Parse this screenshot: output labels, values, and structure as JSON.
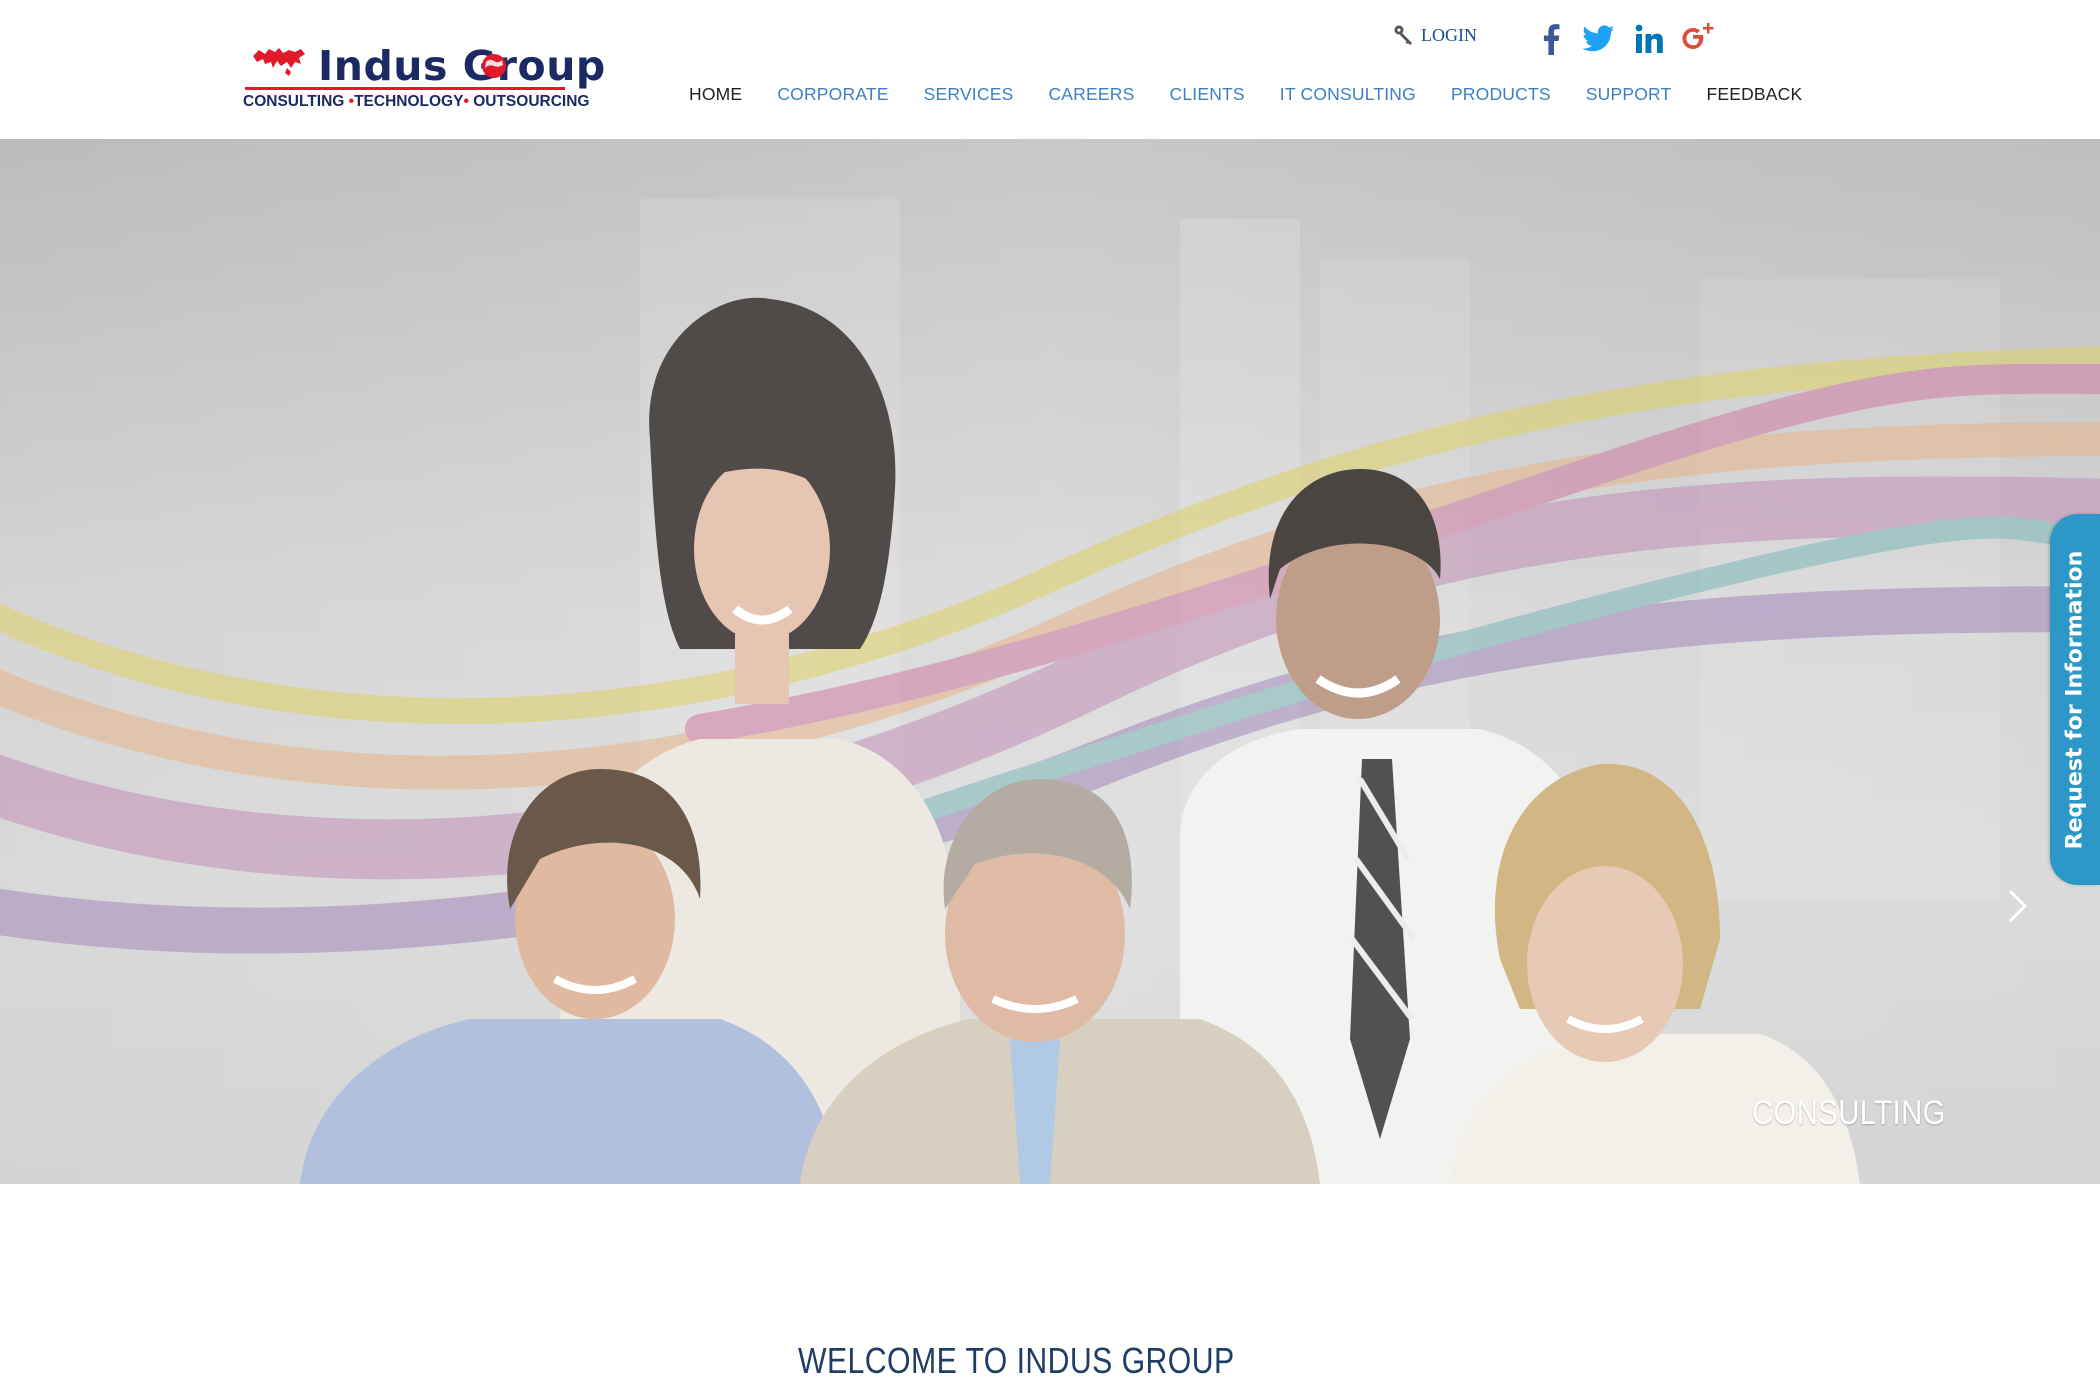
{
  "brand": {
    "name": "Indus Group",
    "tagline_parts": [
      "CONSULTING",
      "TECHNOLOGY",
      "OUTSOURCING"
    ],
    "colors": {
      "navy": "#1b2a63",
      "red": "#e0192b"
    }
  },
  "header": {
    "login_label": "LOGIN",
    "social": [
      {
        "name": "facebook-icon",
        "color": "#3b5998"
      },
      {
        "name": "twitter-icon",
        "color": "#1da1f2"
      },
      {
        "name": "linkedin-icon",
        "color": "#0077b5"
      },
      {
        "name": "google-plus-icon",
        "color": "#dd4b39"
      }
    ]
  },
  "nav": {
    "items": [
      {
        "label": "HOME"
      },
      {
        "label": "CORPORATE"
      },
      {
        "label": "SERVICES"
      },
      {
        "label": "CAREERS"
      },
      {
        "label": "CLIENTS"
      },
      {
        "label": "IT CONSULTING"
      },
      {
        "label": "PRODUCTS"
      },
      {
        "label": "SUPPORT"
      },
      {
        "label": "FEEDBACK"
      }
    ],
    "colors": {
      "link": "#3d7fc1",
      "active": "#222222"
    }
  },
  "hero": {
    "caption": "CONSULTING",
    "next_icon": "chevron-right-icon",
    "side_tab_label": "Request for Information",
    "side_tab_color": "#2d97c7"
  },
  "welcome": {
    "heading": "WELCOME TO INDUS GROUP"
  }
}
